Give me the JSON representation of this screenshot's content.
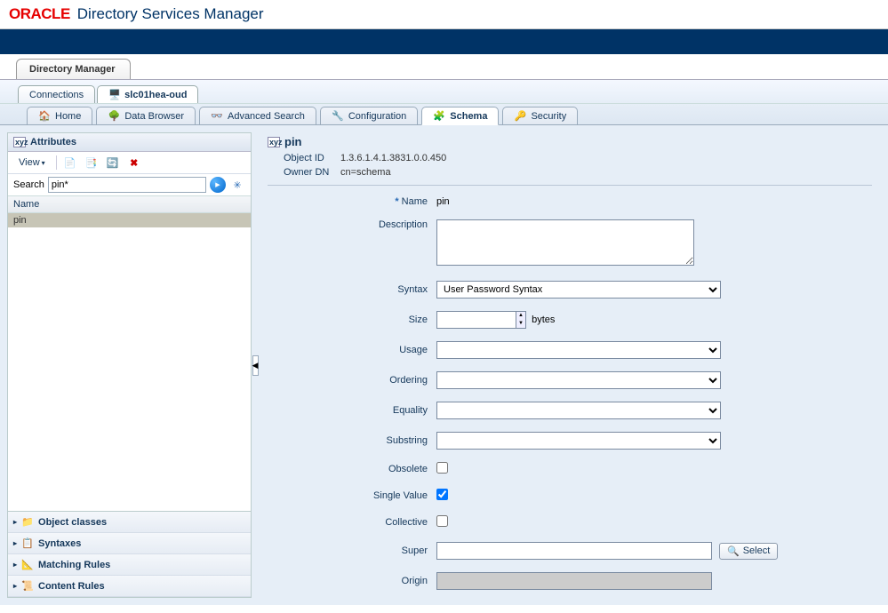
{
  "header": {
    "logo": "ORACLE",
    "title": "Directory Services Manager"
  },
  "level1": {
    "tab1": "Directory Manager"
  },
  "level2": {
    "connections": "Connections",
    "server": "slc01hea-oud"
  },
  "nav": {
    "home": "Home",
    "data_browser": "Data Browser",
    "advanced_search": "Advanced Search",
    "configuration": "Configuration",
    "schema": "Schema",
    "security": "Security"
  },
  "sidebar": {
    "attributes_title": "Attributes",
    "view": "View",
    "search_label": "Search",
    "search_value": "pin*",
    "col_name": "Name",
    "rows": [
      "pin"
    ],
    "accordion": {
      "object_classes": "Object classes",
      "syntaxes": "Syntaxes",
      "matching_rules": "Matching Rules",
      "content_rules": "Content Rules"
    }
  },
  "detail": {
    "title": "pin",
    "object_id_label": "Object ID",
    "object_id": "1.3.6.1.4.1.3831.0.0.450",
    "owner_dn_label": "Owner DN",
    "owner_dn": "cn=schema",
    "labels": {
      "name": "Name",
      "description": "Description",
      "syntax": "Syntax",
      "size": "Size",
      "size_unit": "bytes",
      "usage": "Usage",
      "ordering": "Ordering",
      "equality": "Equality",
      "substring": "Substring",
      "obsolete": "Obsolete",
      "single_value": "Single Value",
      "collective": "Collective",
      "super": "Super",
      "origin": "Origin",
      "select": "Select"
    },
    "values": {
      "name": "pin",
      "syntax": "User Password Syntax",
      "single_value": true
    }
  }
}
